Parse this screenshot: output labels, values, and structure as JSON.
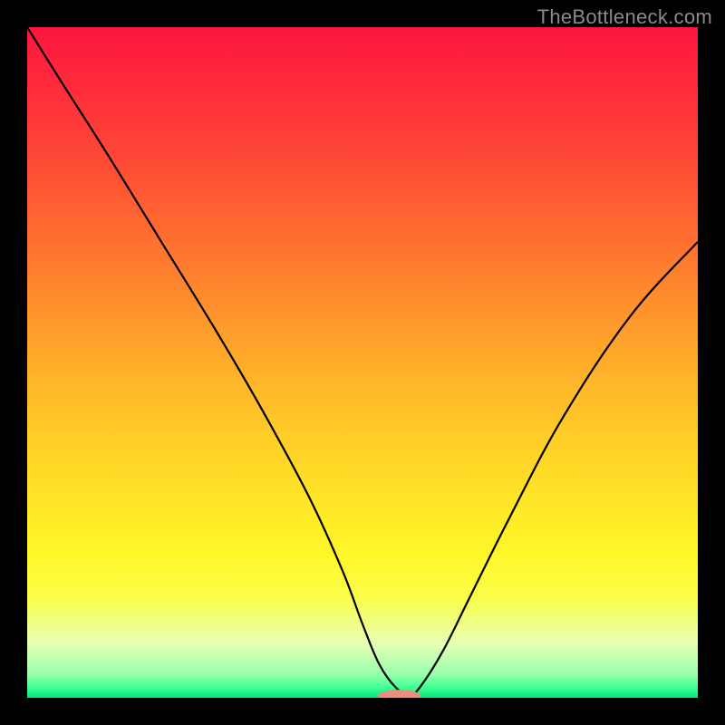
{
  "watermark": "TheBottleneck.com",
  "colors": {
    "bg": "#000000",
    "curve": "#000000",
    "marker_fill": "#ed8b80",
    "gradient_stops": [
      {
        "offset": 0.0,
        "color": "#fd163f"
      },
      {
        "offset": 0.1,
        "color": "#fe2e3a"
      },
      {
        "offset": 0.2,
        "color": "#fe4a35"
      },
      {
        "offset": 0.3,
        "color": "#ff6a31"
      },
      {
        "offset": 0.4,
        "color": "#ff8b2d"
      },
      {
        "offset": 0.5,
        "color": "#ffac2a"
      },
      {
        "offset": 0.6,
        "color": "#ffca28"
      },
      {
        "offset": 0.7,
        "color": "#ffe427"
      },
      {
        "offset": 0.78,
        "color": "#fff627"
      },
      {
        "offset": 0.85,
        "color": "#fbff48"
      },
      {
        "offset": 0.92,
        "color": "#e6ffb4"
      },
      {
        "offset": 0.965,
        "color": "#97ffad"
      },
      {
        "offset": 0.985,
        "color": "#3dff92"
      },
      {
        "offset": 1.0,
        "color": "#00e676"
      }
    ]
  },
  "chart_data": {
    "type": "line",
    "title": "",
    "xlabel": "",
    "ylabel": "",
    "xlim": [
      0,
      100
    ],
    "ylim": [
      0,
      100
    ],
    "curve": {
      "name": "bottleneck-curve",
      "x": [
        0,
        5,
        12,
        20,
        28,
        35,
        42,
        47,
        50,
        52.5,
        55,
        57,
        58.5,
        62,
        66,
        72,
        80,
        90,
        100
      ],
      "y": [
        100,
        92,
        81,
        68,
        55,
        43,
        30,
        19,
        11,
        5,
        1.5,
        0.5,
        1.5,
        7,
        15,
        27,
        42,
        57,
        68
      ]
    },
    "marker": {
      "x": 55.5,
      "y": 0.3,
      "rx": 3.2,
      "ry": 0.9
    }
  }
}
